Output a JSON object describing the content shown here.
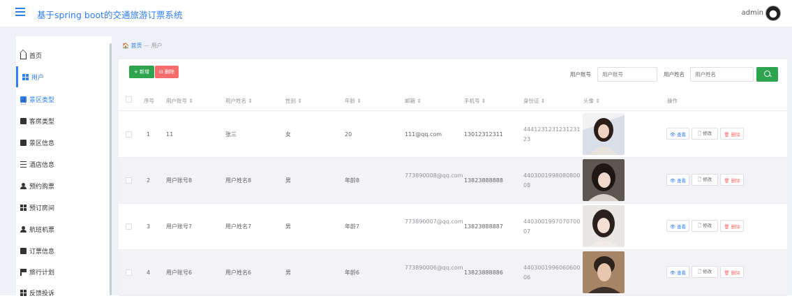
{
  "header": {
    "app_title": "基于spring boot的交通旅游订票系统",
    "user": "admin"
  },
  "sidebar": {
    "items": [
      {
        "label": "首页",
        "icon": "home-icon"
      },
      {
        "label": "用户",
        "icon": "grid-icon"
      },
      {
        "label": "景区类型",
        "icon": "card-icon"
      },
      {
        "label": "客房类型",
        "icon": "clipboard-icon"
      },
      {
        "label": "景区信息",
        "icon": "clipboard-icon"
      },
      {
        "label": "酒店信息",
        "icon": "list-icon"
      },
      {
        "label": "预约购票",
        "icon": "user-icon"
      },
      {
        "label": "预订房间",
        "icon": "grid-icon"
      },
      {
        "label": "航班机票",
        "icon": "user-icon"
      },
      {
        "label": "订票信息",
        "icon": "clipboard-icon"
      },
      {
        "label": "旅行计划",
        "icon": "flag-icon"
      },
      {
        "label": "反馈投诉",
        "icon": "grid-icon"
      }
    ]
  },
  "breadcrumb": {
    "home": "首页",
    "sep": "—",
    "current": "用户"
  },
  "toolbar": {
    "add_label": "+ 新增",
    "delete_label": "⊟ 删除"
  },
  "search": {
    "account_label": "用户账号",
    "account_placeholder": "用户账号",
    "name_label": "用户姓名",
    "name_placeholder": "用户姓名"
  },
  "table": {
    "headers": {
      "index": "序号",
      "account": "用户账号 ⇕",
      "name": "用户姓名 ⇕",
      "gender": "性别 ⇕",
      "age": "年龄 ⇕",
      "email": "邮箱 ⇕",
      "phone": "手机号 ⇕",
      "idcard": "身份证 ⇕",
      "avatar": "头像 ⇕",
      "ops": "操作"
    },
    "rows": [
      {
        "index": "1",
        "account": "11",
        "name": "张三",
        "gender": "女",
        "age": "20",
        "email": "111@qq.com",
        "phone": "13012312311",
        "idcard": "444123123123123123"
      },
      {
        "index": "2",
        "account": "用户账号8",
        "name": "用户姓名8",
        "gender": "男",
        "age": "年龄8",
        "email": "773890008@qq.com",
        "phone": "13823888888",
        "idcard": "440300199808080008"
      },
      {
        "index": "3",
        "account": "用户账号7",
        "name": "用户姓名7",
        "gender": "男",
        "age": "年龄7",
        "email": "773890007@qq.com",
        "phone": "13823888887",
        "idcard": "440300199707070007"
      },
      {
        "index": "4",
        "account": "用户账号6",
        "name": "用户姓名6",
        "gender": "男",
        "age": "年龄6",
        "email": "773890006@qq.com",
        "phone": "13823888886",
        "idcard": "440300199606060006"
      }
    ],
    "actions": {
      "view": "👁 查看",
      "edit": "🗋 修改",
      "delete": "🗑 删除"
    }
  },
  "colors": {
    "accent": "#2f80ed",
    "add": "#2ea44f",
    "danger": "#f56c6c"
  }
}
